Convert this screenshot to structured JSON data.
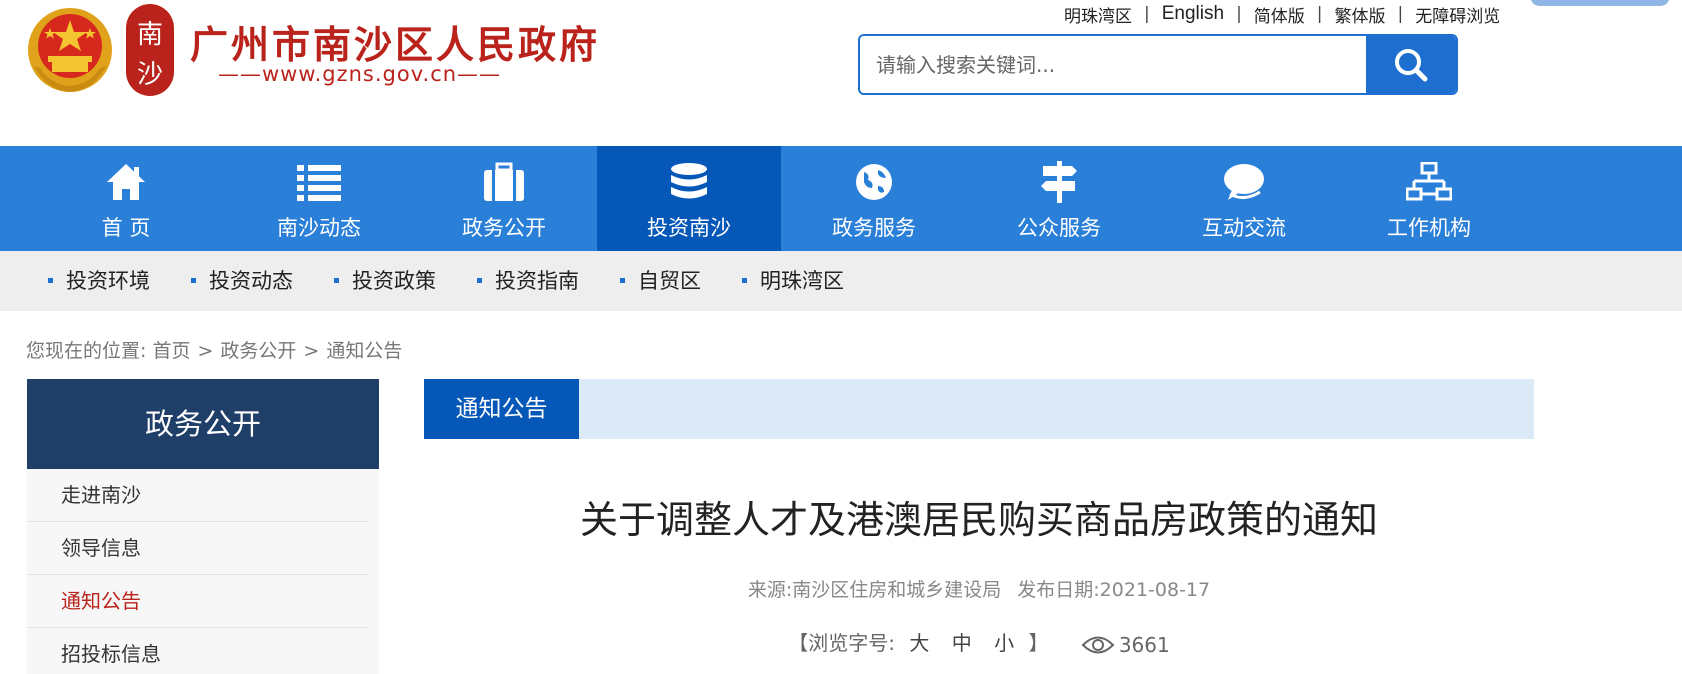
{
  "header": {
    "title": "广州市南沙区人民政府",
    "url_text": "——www.gzns.gov.cn——",
    "seal_chars": [
      "南",
      "沙"
    ],
    "top_links": [
      "明珠湾区",
      "English",
      "简体版",
      "繁体版",
      "无障碍浏览"
    ],
    "search": {
      "placeholder": "请输入搜索关键词..."
    }
  },
  "nav": {
    "items": [
      {
        "label": "首 页",
        "icon": "home-icon"
      },
      {
        "label": "南沙动态",
        "icon": "list-icon"
      },
      {
        "label": "政务公开",
        "icon": "briefcase-icon"
      },
      {
        "label": "投资南沙",
        "icon": "coins-icon"
      },
      {
        "label": "政务服务",
        "icon": "globe-icon"
      },
      {
        "label": "公众服务",
        "icon": "signpost-icon"
      },
      {
        "label": "互动交流",
        "icon": "chat-icon"
      },
      {
        "label": "工作机构",
        "icon": "org-chart-icon"
      }
    ],
    "active_index": 3
  },
  "subnav": {
    "items": [
      "投资环境",
      "投资动态",
      "投资政策",
      "投资指南",
      "自贸区",
      "明珠湾区"
    ]
  },
  "breadcrumb": {
    "prefix": "您现在的位置:",
    "items": [
      "首页",
      "政务公开",
      "通知公告"
    ]
  },
  "sidebar": {
    "title": "政务公开",
    "items": [
      "走进南沙",
      "领导信息",
      "通知公告",
      "招投标信息"
    ],
    "active_index": 2
  },
  "content": {
    "tab": "通知公告",
    "article_title": "关于调整人才及港澳居民购买商品房政策的通知",
    "source": "来源:南沙区住房和城乡建设局",
    "date": "发布日期:2021-08-17",
    "font_size_label_open": "【浏览字号:",
    "font_sizes": [
      "大",
      "中",
      "小"
    ],
    "font_size_label_close": "】",
    "view_count": "3661"
  },
  "colors": {
    "brand_red": "#b9231b",
    "nav_blue": "#2a7fd8",
    "nav_active": "#0557b8",
    "sidebar_title_bg": "#1f3e68"
  }
}
